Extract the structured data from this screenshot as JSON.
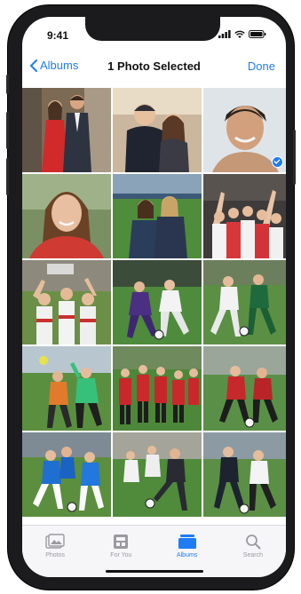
{
  "status": {
    "time": "9:41"
  },
  "nav": {
    "back_label": "Albums",
    "title": "1 Photo Selected",
    "done_label": "Done"
  },
  "photos": [
    {
      "name": "photo-couple-formal",
      "selected": false
    },
    {
      "name": "photo-couple-selfie",
      "selected": false
    },
    {
      "name": "photo-boy-portrait",
      "selected": true
    },
    {
      "name": "photo-girl-portrait",
      "selected": false
    },
    {
      "name": "photo-two-girls-stadium",
      "selected": false
    },
    {
      "name": "photo-team-celebration",
      "selected": false
    },
    {
      "name": "photo-three-players",
      "selected": false
    },
    {
      "name": "photo-soccer-action-purple",
      "selected": false
    },
    {
      "name": "photo-soccer-action-green",
      "selected": false
    },
    {
      "name": "photo-goalkeeper-save",
      "selected": false
    },
    {
      "name": "photo-red-team-celebrate",
      "selected": false
    },
    {
      "name": "photo-red-vs-white",
      "selected": false
    },
    {
      "name": "photo-blue-players",
      "selected": false
    },
    {
      "name": "photo-player-kicking",
      "selected": false
    },
    {
      "name": "photo-dark-vs-white",
      "selected": false
    }
  ],
  "tabs": [
    {
      "label": "Photos",
      "icon": "photos-icon",
      "active": false
    },
    {
      "label": "For You",
      "icon": "for-you-icon",
      "active": false
    },
    {
      "label": "Albums",
      "icon": "albums-icon",
      "active": true
    },
    {
      "label": "Search",
      "icon": "search-icon",
      "active": false
    }
  ],
  "colors": {
    "accent": "#1e7cf7",
    "frame": "#1b1b1d",
    "tabbar": "#f6f6f8"
  }
}
